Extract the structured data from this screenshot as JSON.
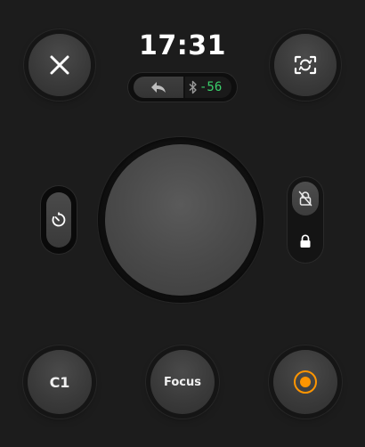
{
  "status": {
    "time": "17:31",
    "signal_value": "-56"
  },
  "buttons": {
    "c1_label": "C1",
    "focus_label": "Focus"
  },
  "colors": {
    "background": "#1c1c1c",
    "signal_green": "#3ad06b",
    "record_orange": "#ff9500"
  },
  "icons": {
    "close": "close-icon",
    "screenshot": "screenshot-icon",
    "back": "back-arrow-icon",
    "bluetooth": "bluetooth-icon",
    "timer": "timer-icon",
    "lock_off": "lock-off-icon",
    "lock": "lock-icon",
    "record": "record-icon"
  }
}
